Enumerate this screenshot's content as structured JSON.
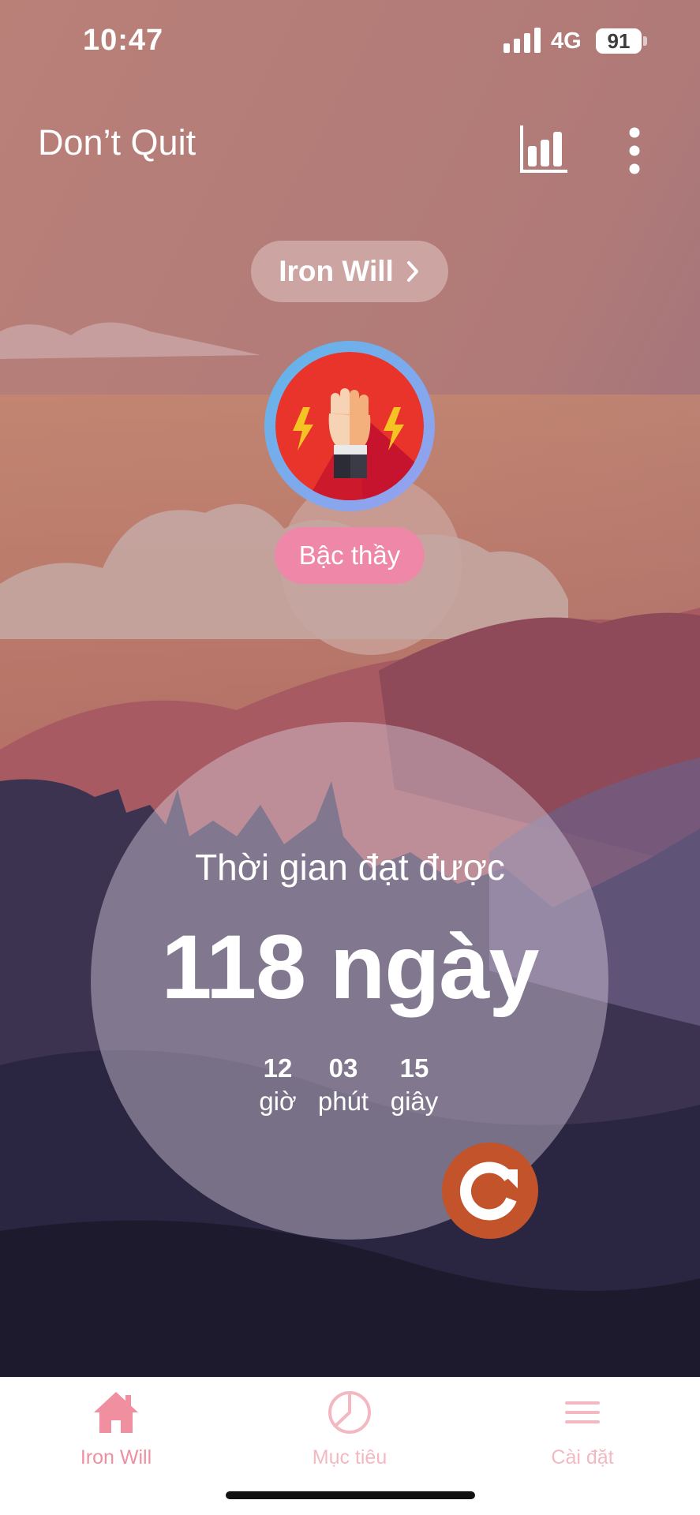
{
  "status": {
    "time": "10:47",
    "network": "4G",
    "battery": "91"
  },
  "header": {
    "title": "Don’t Quit"
  },
  "profile": {
    "name": "Iron Will",
    "level": "Bậc thầy"
  },
  "timer": {
    "label": "Thời gian đạt được",
    "days": "118 ngày",
    "hours_value": "12",
    "hours_label": "giờ",
    "minutes_value": "03",
    "minutes_label": "phút",
    "seconds_value": "15",
    "seconds_label": "giây"
  },
  "tabs": [
    {
      "label": "Iron Will",
      "icon": "home-icon",
      "active": true
    },
    {
      "label": "Mục tiêu",
      "icon": "pie-chart-icon",
      "active": false
    },
    {
      "label": "Cài đặt",
      "icon": "menu-icon",
      "active": false
    }
  ],
  "colors": {
    "accent": "#ef8fa0",
    "reset_button": "#c2532a",
    "level_badge": "#ef88a8"
  }
}
